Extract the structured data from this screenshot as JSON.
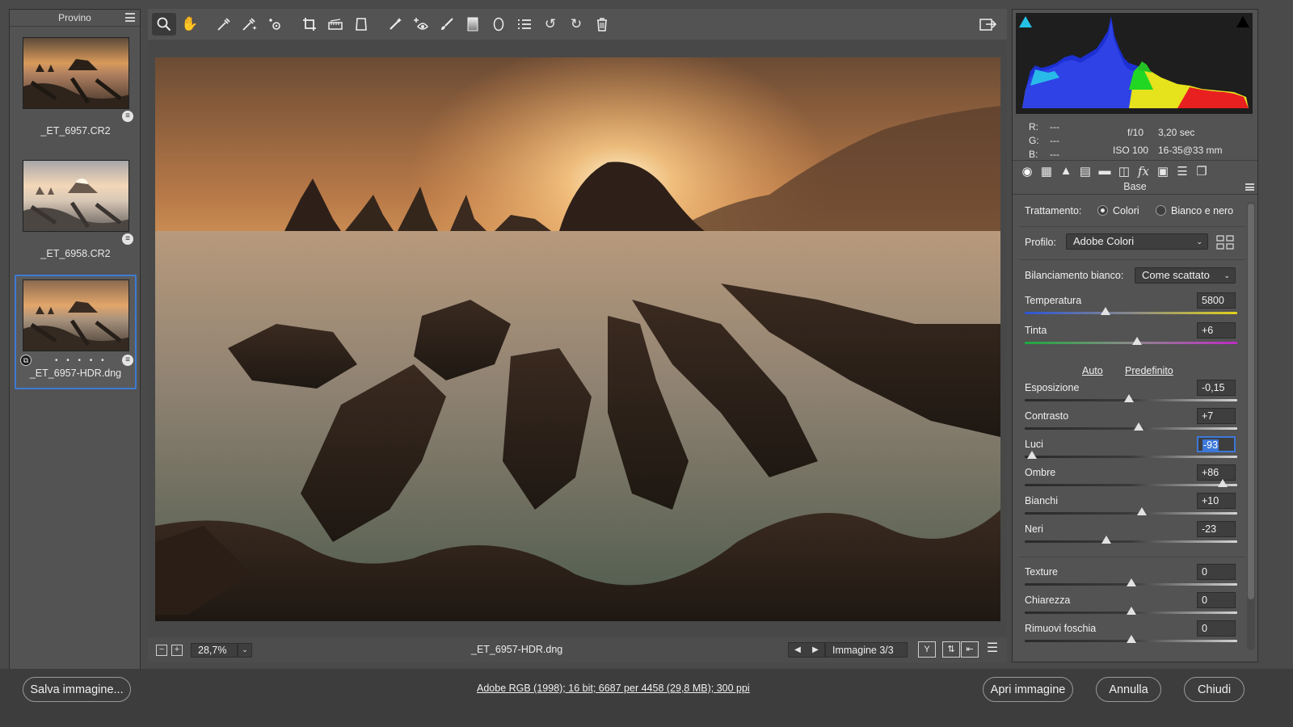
{
  "filmstrip": {
    "title": "Provino",
    "items": [
      {
        "name": "_ET_6957.CR2",
        "selected": false
      },
      {
        "name": "_ET_6958.CR2",
        "selected": false
      },
      {
        "name": "_ET_6957-HDR.dng",
        "selected": true,
        "dots": "• • • • •"
      }
    ]
  },
  "toolbar": {
    "tools": [
      "zoom-icon",
      "hand-icon",
      "white-balance-icon",
      "color-sampler-icon",
      "targeted-adjustment-icon",
      "crop-icon",
      "straighten-icon",
      "transform-icon",
      "spot-removal-icon",
      "red-eye-icon",
      "adjustment-brush-icon",
      "graduated-filter-icon",
      "radial-filter-icon",
      "list-icon",
      "rotate-left-icon",
      "rotate-right-icon",
      "trash-icon"
    ]
  },
  "bottombar": {
    "zoom": "28,7%",
    "filename": "_ET_6957-HDR.dng",
    "image_counter": "Immagine 3/3"
  },
  "exif": {
    "r_label": "R:",
    "g_label": "G:",
    "b_label": "B:",
    "r": "---",
    "g": "---",
    "b": "---",
    "aperture": "f/10",
    "shutter": "3,20 sec",
    "iso": "ISO 100",
    "lens": "16-35@33 mm"
  },
  "panel": {
    "title": "Base",
    "treatment_label": "Trattamento:",
    "treatment_color": "Colori",
    "treatment_bw": "Bianco e nero",
    "profile_label": "Profilo:",
    "profile_value": "Adobe Colori",
    "wb_label": "Bilanciamento bianco:",
    "wb_value": "Come scattato",
    "auto_link": "Auto",
    "default_link": "Predefinito"
  },
  "sliders": {
    "temperatura": {
      "label": "Temperatura",
      "value": "5800",
      "fraction": 0.38
    },
    "tinta": {
      "label": "Tinta",
      "value": "+6",
      "fraction": 0.53
    },
    "esposizione": {
      "label": "Esposizione",
      "value": "-0,15",
      "fraction": 0.49
    },
    "contrasto": {
      "label": "Contrasto",
      "value": "+7",
      "fraction": 0.535
    },
    "luci": {
      "label": "Luci",
      "value": "-93",
      "fraction": 0.035
    },
    "ombre": {
      "label": "Ombre",
      "value": "+86",
      "fraction": 0.93
    },
    "bianchi": {
      "label": "Bianchi",
      "value": "+10",
      "fraction": 0.55
    },
    "neri": {
      "label": "Neri",
      "value": "-23",
      "fraction": 0.385
    },
    "texture": {
      "label": "Texture",
      "value": "0",
      "fraction": 0.5
    },
    "chiarezza": {
      "label": "Chiarezza",
      "value": "0",
      "fraction": 0.5
    },
    "foschia": {
      "label": "Rimuovi foschia",
      "value": "0",
      "fraction": 0.5
    }
  },
  "footer": {
    "save": "Salva immagine...",
    "info": "Adobe RGB (1998); 16 bit; 6687 per 4458 (29,8 MB); 300 ppi",
    "open": "Apri immagine",
    "cancel": "Annulla",
    "close": "Chiudi"
  },
  "colors": {
    "accent": "#3c78d8",
    "panel_bg": "#535353",
    "app_bg": "#4a4a4a"
  }
}
